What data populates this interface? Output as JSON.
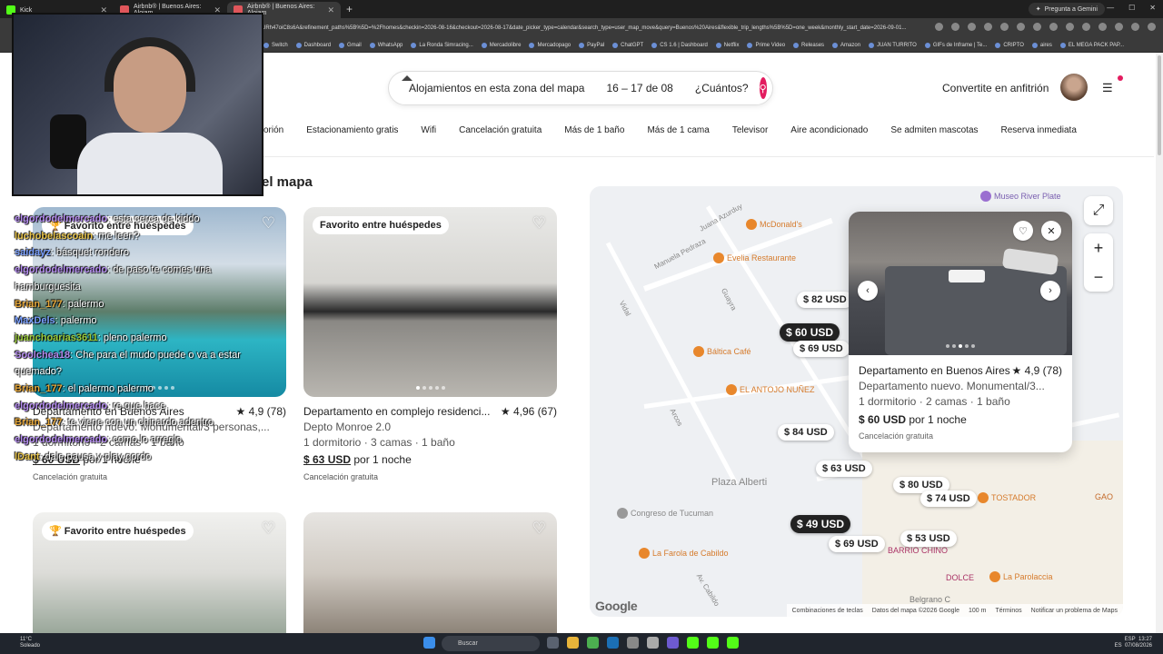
{
  "browser": {
    "tabs": [
      {
        "label": "Kick"
      },
      {
        "label": "Airbnb® | Buenos Aires: Alojam"
      },
      {
        "label": "Airbnb® | Buenos Aires: Alojam"
      }
    ],
    "gemini": "Pregunta a Gemini",
    "url": "URh47oiC8s6A&refinement_paths%5B%5D=%2Fhomes&checkin=2026-08-16&checkout=2026-08-17&date_picker_type=calendar&search_type=user_map_move&query=Buenos%20Aires&flexible_trip_lengths%5B%5D=one_week&monthly_start_date=2026-09-01...",
    "bookmarks": [
      "Switch",
      "Dashboard",
      "Gmail",
      "WhatsApp",
      "La Ronda Simracing...",
      "Mercadolibre",
      "Mercadopago",
      "PayPal",
      "ChatGPT",
      "CS 1.6 | Dashboard",
      "Netflix",
      "Prime Video",
      "Releases",
      "Amazon",
      "JUAN TURRITO",
      "GIFs de Inframe | Te...",
      "CRIPTO",
      "aires",
      "EL MEGA PACK PAP..."
    ]
  },
  "header": {
    "search_location": "Alojamientos en esta zona del mapa",
    "search_dates": "16 – 17 de 08",
    "search_guests": "¿Cuántos?",
    "host_link": "Convertite en anfitrión",
    "accent": "#e31c5f"
  },
  "filters": [
    "orión",
    "Estacionamiento gratis",
    "Wifi",
    "Cancelación gratuita",
    "Más de 1 baño",
    "Más de 1 cama",
    "Televisor",
    "Aire acondicionado",
    "Se admiten mascotas",
    "Reserva inmediata"
  ],
  "section_title": "el mapa",
  "listings": [
    {
      "badge": "Favorito entre huéspedes",
      "title": "Departamento en Buenos Aires",
      "rating": "★ 4,9 (78)",
      "subtitle": "Departamento nuevo. Monumental/3 personas,...",
      "details": "1 dormitorio · 2 camas · 1 baño",
      "price": "$ 60 USD",
      "per": "por 1 noche",
      "cancel": "Cancelación gratuita"
    },
    {
      "badge": "Favorito entre huéspedes",
      "title": "Departamento en complejo residenci...",
      "rating": "★ 4,96 (67)",
      "subtitle": "Depto Monroe 2.0",
      "details": "1 dormitorio · 3 camas · 1 baño",
      "price": "$ 63 USD",
      "per": "por 1 noche",
      "cancel": "Cancelación gratuita"
    },
    {
      "badge": "Favorito entre huéspedes"
    },
    {
      "badge": ""
    }
  ],
  "chat": [
    {
      "user": "elgordodelmercado",
      "msg": ": esta cerca de kiddo",
      "color": "#b58cf0"
    },
    {
      "user": "luchobelascoain",
      "msg": ": me leen?",
      "color": "#e7c34a"
    },
    {
      "user": "saidayz",
      "msg": ": básquet rondero",
      "color": "#7aa0ff"
    },
    {
      "user": "elgordodelmercado",
      "msg": ": de paso te comes una hamburguesita",
      "color": "#b58cf0"
    },
    {
      "user": "Brian_177",
      "msg": ": palermo",
      "color": "#e7a83b"
    },
    {
      "user": "MaxDels",
      "msg": ": palermo",
      "color": "#7aa0ff"
    },
    {
      "user": "juanchoarias3611",
      "msg": ": pleno palermo",
      "color": "#9ccc3c"
    },
    {
      "user": "Soolchea18",
      "msg": ": Che para el mudo puede o va a estar quemado?",
      "color": "#b58cf0"
    },
    {
      "user": "Brian_177",
      "msg": ": el palermo palermo",
      "color": "#e7a83b"
    },
    {
      "user": "elgordodelmercado",
      "msg": ": re que hace",
      "color": "#b58cf0"
    },
    {
      "user": "Brian_177",
      "msg": ": te viene con un chinardo adentro",
      "color": "#e7a83b"
    },
    {
      "user": "elgordodelmercado",
      "msg": ": como lo arreglo",
      "color": "#b58cf0"
    },
    {
      "user": "lDant",
      "msg": ": dale pausa y play gordo",
      "color": "#e7c34a"
    }
  ],
  "map": {
    "pins": [
      {
        "label": "$ 82 USD"
      },
      {
        "label": "$ 60 USD"
      },
      {
        "label": "$ 69 USD"
      },
      {
        "label": "$ 84 USD"
      },
      {
        "label": "$ 63 USD"
      },
      {
        "label": "$ 80 USD"
      },
      {
        "label": "$ 74 USD"
      },
      {
        "label": "$ 49 USD"
      },
      {
        "label": "$ 53 USD"
      },
      {
        "label": "$ 69 USD"
      }
    ],
    "pois": [
      "Museo River Plate",
      "McDonald's",
      "Evelia Restaurante",
      "Báltica Café",
      "EL ANTOJO NUÑEZ",
      "Plaza Alberti",
      "Congreso de Tucuman",
      "La Farola de Cabildo",
      "TOSTADOR",
      "GAO",
      "BARRIO CHINO",
      "DOLCE",
      "La Parolaccia",
      "Belgrano C"
    ],
    "streets": [
      "Manuela Pedraza",
      "Av. Cabildo",
      "Arcos",
      "Guayra",
      "Vidal",
      "Juana Azurduy",
      "Ciudad de la Paz"
    ],
    "popup": {
      "title": "Departamento en Buenos Aires",
      "rating": "★ 4,9 (78)",
      "subtitle": "Departamento nuevo. Monumental/3...",
      "details": "1 dormitorio · 2 camas · 1 baño",
      "price": "$ 60 USD",
      "per": "por 1 noche",
      "cancel": "Cancelación gratuita"
    },
    "google": "Google",
    "attribution": [
      "Combinaciones de teclas",
      "Datos del mapa ©2026 Google",
      "100 m",
      "Términos",
      "Notificar un problema de Maps"
    ]
  },
  "taskbar": {
    "weather_temp": "11°C",
    "weather_text": "Soleado",
    "search": "Buscar",
    "lang": "ESP",
    "lang2": "ES",
    "time": "13:27",
    "date": "07/08/2026"
  }
}
